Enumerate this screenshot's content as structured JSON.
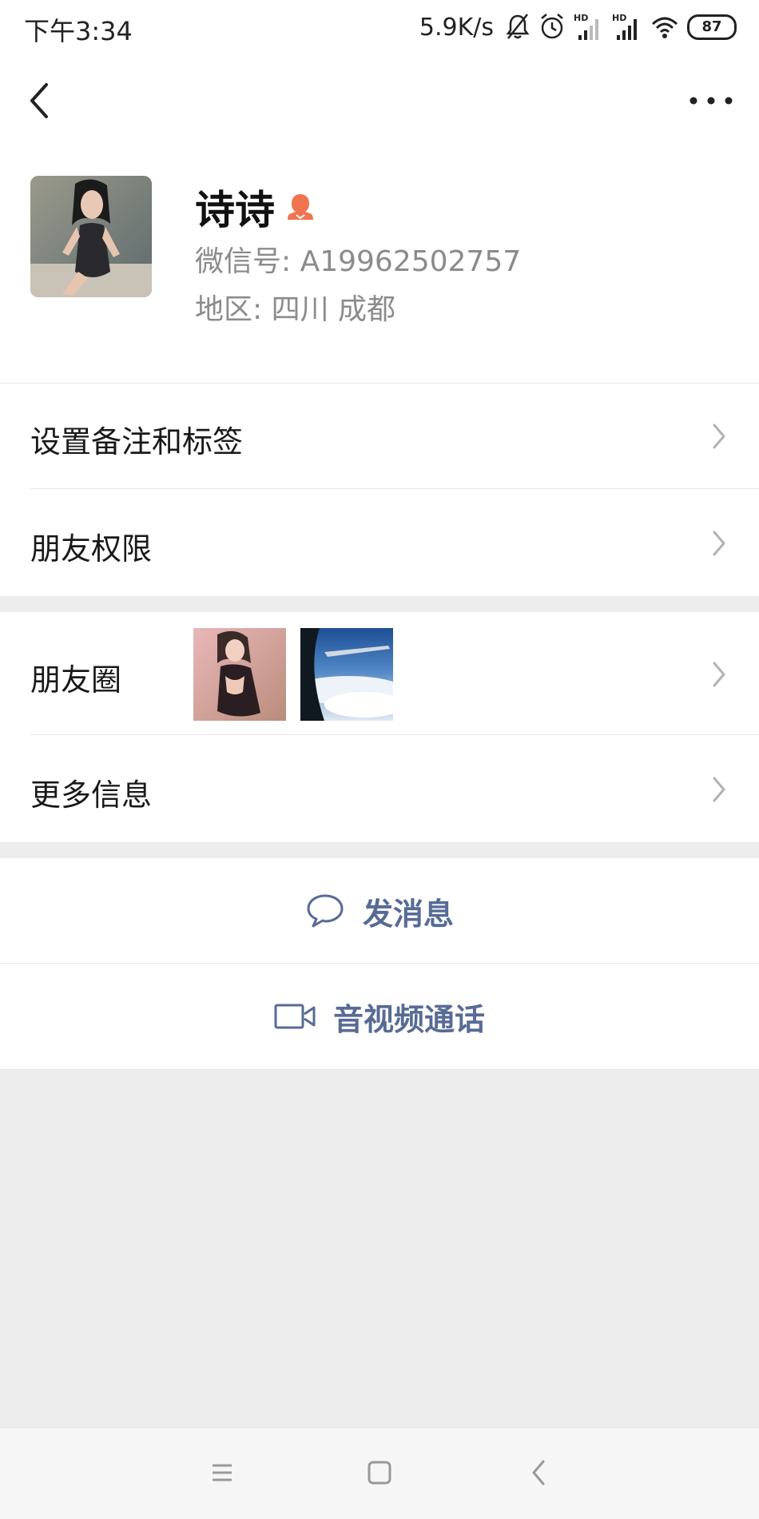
{
  "status_bar": {
    "time": "下午3:34",
    "net_speed": "5.9K/s",
    "battery": "87",
    "icons": [
      "mute-bell-icon",
      "alarm-icon",
      "hd-signal-icon",
      "hd-signal-icon",
      "wifi-icon",
      "battery-icon"
    ]
  },
  "nav": {
    "back_icon": "chevron-left-icon",
    "more_icon": "more-dots-icon"
  },
  "profile": {
    "name": "诗诗",
    "gender_icon": "female-icon",
    "wechat_id": "微信号: A19962502757",
    "region": "地区: 四川  成都"
  },
  "menu": {
    "remark_tags": "设置备注和标签",
    "friend_permissions": "朋友权限",
    "moments": "朋友圈",
    "more_info": "更多信息"
  },
  "actions": {
    "send_message": "发消息",
    "av_call": "音视频通话"
  },
  "colors": {
    "link_blue": "#576b95",
    "female_accent": "#f0744f",
    "page_bg": "#ededed"
  }
}
